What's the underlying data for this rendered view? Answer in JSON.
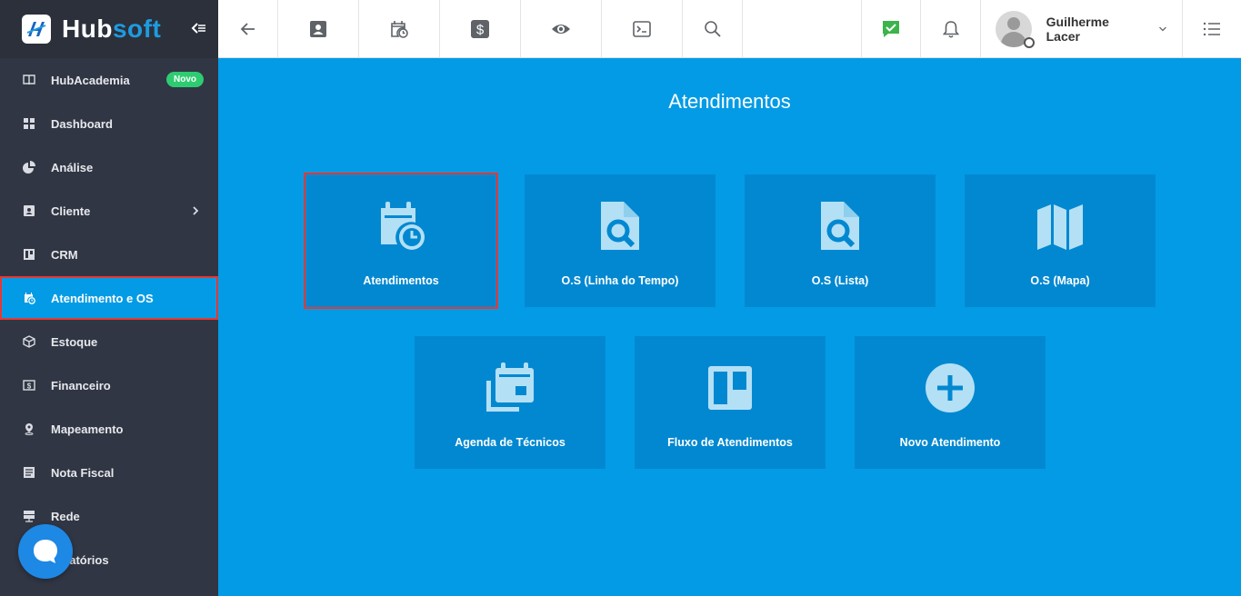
{
  "brand": {
    "name_part1": "Hub",
    "name_part2": "soft"
  },
  "sidebar": {
    "items": [
      {
        "label": "HubAcademia",
        "icon": "book-icon",
        "badge": "Novo"
      },
      {
        "label": "Dashboard",
        "icon": "grid-icon"
      },
      {
        "label": "Análise",
        "icon": "pie-chart-icon"
      },
      {
        "label": "Cliente",
        "icon": "contact-card-icon"
      },
      {
        "label": "CRM",
        "icon": "kanban-icon"
      },
      {
        "label": "Atendimento e OS",
        "icon": "calendar-clock-icon",
        "active": true
      },
      {
        "label": "Estoque",
        "icon": "box-icon"
      },
      {
        "label": "Financeiro",
        "icon": "money-icon"
      },
      {
        "label": "Mapeamento",
        "icon": "map-pin-icon"
      },
      {
        "label": "Nota Fiscal",
        "icon": "document-icon"
      },
      {
        "label": "Rede",
        "icon": "server-icon"
      },
      {
        "label": "Relatórios",
        "icon": "report-icon"
      }
    ]
  },
  "topbar": {
    "icons": [
      "back-arrow-icon",
      "contact-card-icon",
      "calendar-clock-icon",
      "dollar-icon",
      "eye-icon",
      "terminal-icon",
      "search-icon",
      "chat-check-icon",
      "bell-icon",
      "list-menu-icon"
    ],
    "user_name": "Guilherme Lacer"
  },
  "main": {
    "title": "Atendimentos",
    "tiles": [
      {
        "label": "Atendimentos",
        "icon": "calendar-clock-icon",
        "selected": true
      },
      {
        "label": "O.S (Linha do Tempo)",
        "icon": "file-search-icon"
      },
      {
        "label": "O.S (Lista)",
        "icon": "file-search-icon"
      },
      {
        "label": "O.S (Mapa)",
        "icon": "map-icon"
      },
      {
        "label": "Agenda de Técnicos",
        "icon": "calendar-stack-icon"
      },
      {
        "label": "Fluxo de Atendimentos",
        "icon": "kanban-board-icon"
      },
      {
        "label": "Novo Atendimento",
        "icon": "plus-circle-icon"
      }
    ]
  },
  "colors": {
    "sidebar_bg": "#313644",
    "main_bg": "#039be5",
    "tile_bg": "#0288d1",
    "highlight": "#e53935",
    "badge": "#2ecc71"
  }
}
